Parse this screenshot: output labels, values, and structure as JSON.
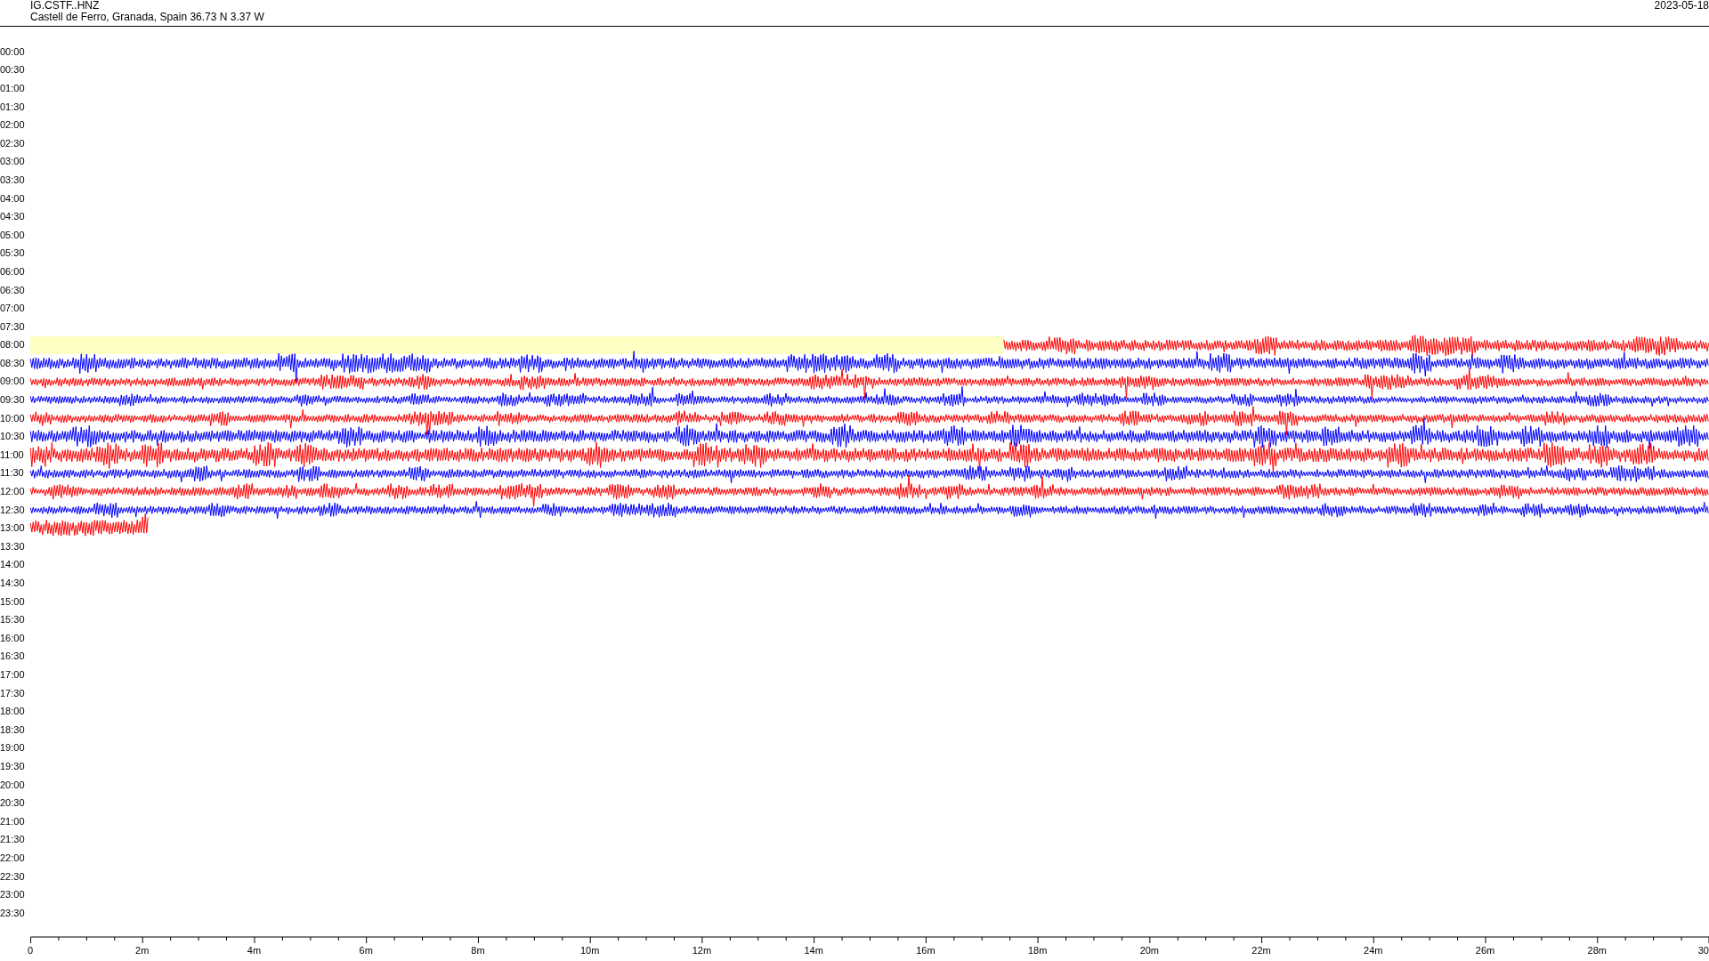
{
  "header": {
    "station": "IG.CSTF..HNZ",
    "location": "Castell de Ferro, Granada, Spain  36.73 N 3.37 W",
    "date": "2023-05-18"
  },
  "rows": [
    {
      "time": "00:00",
      "kind": "empty"
    },
    {
      "time": "00:30",
      "kind": "empty"
    },
    {
      "time": "01:00",
      "kind": "empty"
    },
    {
      "time": "01:30",
      "kind": "empty"
    },
    {
      "time": "02:00",
      "kind": "empty"
    },
    {
      "time": "02:30",
      "kind": "empty"
    },
    {
      "time": "03:00",
      "kind": "empty"
    },
    {
      "time": "03:30",
      "kind": "empty"
    },
    {
      "time": "04:00",
      "kind": "empty"
    },
    {
      "time": "04:30",
      "kind": "empty"
    },
    {
      "time": "05:00",
      "kind": "empty"
    },
    {
      "time": "05:30",
      "kind": "empty"
    },
    {
      "time": "06:00",
      "kind": "empty"
    },
    {
      "time": "06:30",
      "kind": "empty"
    },
    {
      "time": "07:00",
      "kind": "empty"
    },
    {
      "time": "07:30",
      "kind": "empty"
    },
    {
      "time": "08:00",
      "kind": "late-start",
      "color": "#ff0000",
      "highlighted": true
    },
    {
      "time": "08:30",
      "kind": "full",
      "color": "#0000ff"
    },
    {
      "time": "09:00",
      "kind": "full",
      "color": "#ff0000"
    },
    {
      "time": "09:30",
      "kind": "full",
      "color": "#0000ff"
    },
    {
      "time": "10:00",
      "kind": "full",
      "color": "#ff0000"
    },
    {
      "time": "10:30",
      "kind": "full",
      "color": "#0000ff"
    },
    {
      "time": "11:00",
      "kind": "full",
      "color": "#ff0000"
    },
    {
      "time": "11:30",
      "kind": "full",
      "color": "#0000ff"
    },
    {
      "time": "12:00",
      "kind": "full",
      "color": "#ff0000"
    },
    {
      "time": "12:30",
      "kind": "full",
      "color": "#0000ff"
    },
    {
      "time": "13:00",
      "kind": "early-end",
      "color": "#ff0000"
    },
    {
      "time": "13:30",
      "kind": "empty"
    },
    {
      "time": "14:00",
      "kind": "empty"
    },
    {
      "time": "14:30",
      "kind": "empty"
    },
    {
      "time": "15:00",
      "kind": "empty"
    },
    {
      "time": "15:30",
      "kind": "empty"
    },
    {
      "time": "16:00",
      "kind": "empty"
    },
    {
      "time": "16:30",
      "kind": "empty"
    },
    {
      "time": "17:00",
      "kind": "empty"
    },
    {
      "time": "17:30",
      "kind": "empty"
    },
    {
      "time": "18:00",
      "kind": "empty"
    },
    {
      "time": "18:30",
      "kind": "empty"
    },
    {
      "time": "19:00",
      "kind": "empty"
    },
    {
      "time": "19:30",
      "kind": "empty"
    },
    {
      "time": "20:00",
      "kind": "empty"
    },
    {
      "time": "20:30",
      "kind": "empty"
    },
    {
      "time": "21:00",
      "kind": "empty"
    },
    {
      "time": "21:30",
      "kind": "empty"
    },
    {
      "time": "22:00",
      "kind": "empty"
    },
    {
      "time": "22:30",
      "kind": "empty"
    },
    {
      "time": "23:00",
      "kind": "empty"
    },
    {
      "time": "23:30",
      "kind": "empty"
    }
  ],
  "x_axis": {
    "ticks": [
      "0",
      "2m",
      "4m",
      "6m",
      "8m",
      "10m",
      "12m",
      "14m",
      "16m",
      "18m",
      "20m",
      "22m",
      "24m",
      "26m",
      "28m",
      "30"
    ]
  }
}
